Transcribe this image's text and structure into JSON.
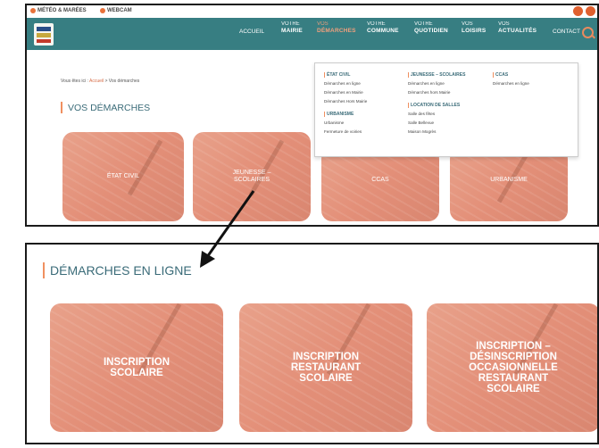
{
  "utility": {
    "weather": "MÉTÉO & MARÉES",
    "webcam": "WEBCAM"
  },
  "nav": {
    "accueil": "ACCUEIL",
    "mairie": [
      "VOTRE",
      "MAIRIE"
    ],
    "demarches": [
      "VOS",
      "DÉMARCHES"
    ],
    "commune": [
      "VOTRE",
      "COMMUNE"
    ],
    "quotidien": [
      "VOTRE",
      "QUOTIDIEN"
    ],
    "loisirs": [
      "VOS",
      "LOISIRS"
    ],
    "actualites": [
      "VOS",
      "ACTUALITÉS"
    ],
    "contact": "CONTACT"
  },
  "breadcrumb": {
    "prefix": "Vous êtes ici :",
    "home": "Accueil",
    "current": "> Vos démarches"
  },
  "top_title": "VOS DÉMARCHES",
  "top_cards": [
    "ÉTAT CIVIL",
    "JEUNESSE –\nSCOLAIRES",
    "CCAS",
    "URBANISME"
  ],
  "dropdown": {
    "etat_civil": {
      "head": "ÉTAT CIVIL",
      "links": [
        "Démarches en ligne",
        "Démarches en Mairie",
        "Démarches Hors Mairie"
      ]
    },
    "urbanisme": {
      "head": "URBANISME",
      "links": [
        "Urbanisme",
        "Fermeture de voiries"
      ]
    },
    "jeunesse": {
      "head": "JEUNESSE – SCOLAIRES",
      "links": [
        "Démarches en ligne",
        "Démarches hors Mairie"
      ]
    },
    "location": {
      "head": "LOCATION DE SALLES",
      "links": [
        "Salle des fêtes",
        "Salle Bellevue",
        "Maison Mogrès"
      ]
    },
    "ccas": {
      "head": "CCAS",
      "links": [
        "Démarches en ligne"
      ]
    }
  },
  "bottom_title": "DÉMARCHES EN LIGNE",
  "bottom_cards": [
    "INSCRIPTION\nSCOLAIRE",
    "INSCRIPTION\nRESTAURANT\nSCOLAIRE",
    "INSCRIPTION –\nDÉSINSCRIPTION\nOCCASIONNELLE\nRESTAURANT\nSCOLAIRE"
  ],
  "colors": {
    "nav_bg": "#377e82",
    "accent": "#f09060",
    "card": "#e3907a",
    "title": "#3a6b78"
  }
}
